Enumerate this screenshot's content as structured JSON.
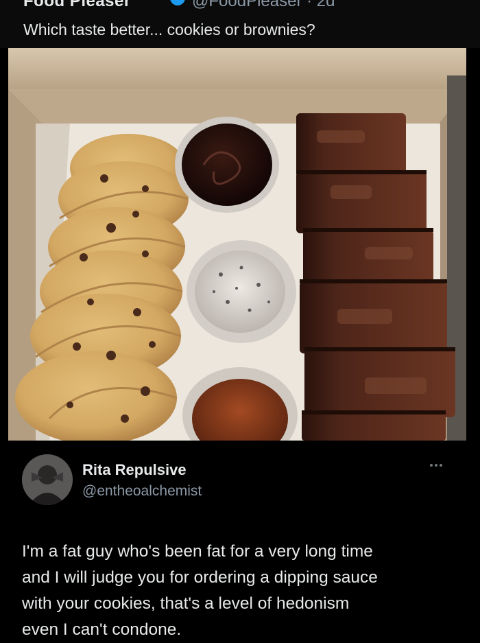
{
  "original_post": {
    "author_name": "Food Pleaser",
    "author_handle": "@FoodPleaser · 2d",
    "text": "Which taste better... cookies or brownies?"
  },
  "photo": {
    "subject": "box of cookies and brownies with dipping sauces",
    "colors": {
      "cardboard": "#c9b59a",
      "cookie": "#d8b06a",
      "brownie": "#5a2f22",
      "chocolate_sauce": "#1e0d0a",
      "caramel_sauce": "#8b3a1a"
    }
  },
  "reply": {
    "author_name": "Rita Repulsive",
    "author_handle": "@entheoalchemist",
    "lines": [
      "I'm a fat guy who's been fat for a very long time",
      "and I will judge you for ordering a dipping sauce",
      "with your cookies, that's a level of hedonism",
      "even I can't condone."
    ]
  },
  "icons": {
    "verified": "verified-badge-icon",
    "more": "more-options-icon"
  }
}
